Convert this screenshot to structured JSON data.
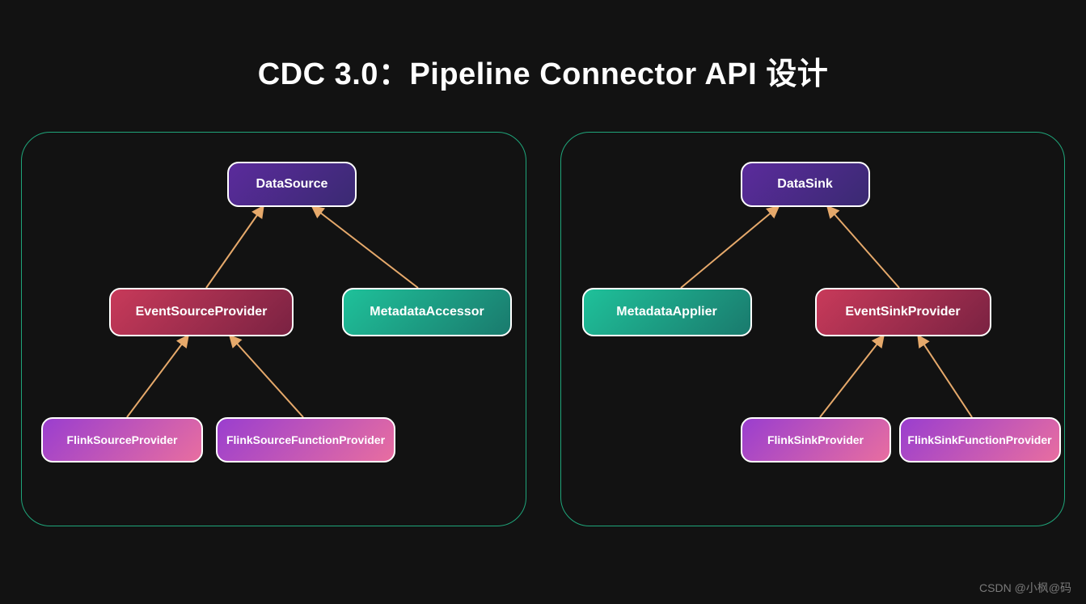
{
  "title": "CDC 3.0：Pipeline Connector API 设计",
  "left": {
    "root": "DataSource",
    "mid_left": "EventSourceProvider",
    "mid_right": "MetadataAccessor",
    "leaf_a": "FlinkSourceProvider",
    "leaf_b": "FlinkSourceFunctionProvider"
  },
  "right": {
    "root": "DataSink",
    "mid_left": "MetadataApplier",
    "mid_right": "EventSinkProvider",
    "leaf_a": "FlinkSinkProvider",
    "leaf_b": "FlinkSinkFunctionProvider"
  },
  "watermark": "CSDN @小枫@码"
}
